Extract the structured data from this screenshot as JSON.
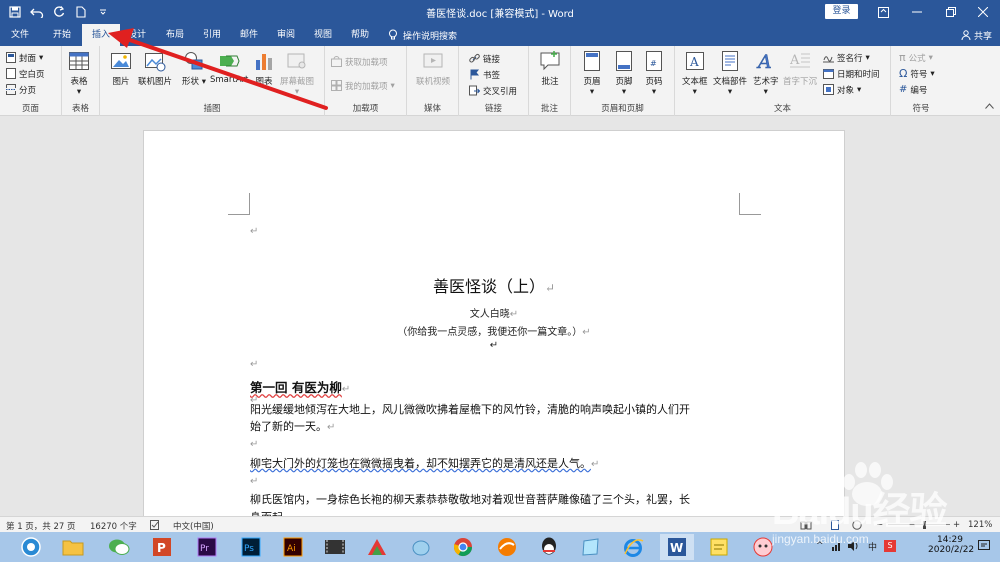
{
  "window": {
    "title": "善医怪谈.doc [兼容模式] - Word",
    "login_label": "登录"
  },
  "tabs": [
    {
      "label": "文件"
    },
    {
      "label": "开始"
    },
    {
      "label": "插入"
    },
    {
      "label": "设计"
    },
    {
      "label": "布局"
    },
    {
      "label": "引用"
    },
    {
      "label": "邮件"
    },
    {
      "label": "审阅"
    },
    {
      "label": "视图"
    },
    {
      "label": "帮助"
    }
  ],
  "active_tab": "插入",
  "tell_me": "操作说明搜索",
  "share": "共享",
  "ribbon": {
    "pages": {
      "label": "页面",
      "cover": "封面",
      "blank": "空白页",
      "break": "分页"
    },
    "tables": {
      "label": "表格",
      "table": "表格"
    },
    "illustrations": {
      "label": "插图",
      "picture": "图片",
      "online_picture": "联机图片",
      "shapes": "形状",
      "smartart": "SmartArt",
      "chart": "图表",
      "screenshot": "屏幕截图"
    },
    "addins": {
      "label": "加载项",
      "get": "获取加载项",
      "my": "我的加载项"
    },
    "media": {
      "label": "媒体",
      "video": "联机视频"
    },
    "links": {
      "label": "链接",
      "link": "链接",
      "bookmark": "书签",
      "crossref": "交叉引用"
    },
    "comments": {
      "label": "批注",
      "comment": "批注"
    },
    "header_footer": {
      "label": "页眉和页脚",
      "header": "页眉",
      "footer": "页脚",
      "page_number": "页码"
    },
    "text": {
      "label": "文本",
      "textbox": "文本框",
      "quickparts": "文档部件",
      "wordart": "艺术字",
      "dropcap": "首字下沉",
      "signature": "签名行",
      "datetime": "日期和时间",
      "object": "对象"
    },
    "symbols": {
      "label": "符号",
      "equation": "公式",
      "symbol": "符号",
      "number": "编号"
    }
  },
  "document": {
    "title": "善医怪谈（上）",
    "author": "文人白晓",
    "tagline": "（你给我一点灵感，我便还你一篇文章。）",
    "chapter": "第一回  有医为柳",
    "para1_line1": "阳光缓缓地倾泻在大地上，风儿微微吹拂着屋檐下的风竹铃，清脆的响声唤起小镇的人们开",
    "para1_line2": "始了新的一天。",
    "para2": "柳宅大门外的灯笼也在微微摇曳着，却不知摆弄它的是清风还是人气。",
    "para3_line1": "柳氏医馆内，一身棕色长袍的柳天素恭恭敬敬地对着观世音菩萨雕像磕了三个头，礼罢，长",
    "para3_line2": "身而起"
  },
  "status": {
    "page": "第 1 页，共 27 页",
    "words": "16270 个字",
    "lang": "中文(中国)",
    "zoom": "121%"
  },
  "taskbar": {
    "clock_time": "14:29",
    "clock_date": "2020/2/22"
  },
  "watermark": {
    "brand": "Baidu经验",
    "url": "jingyan.baidu.com"
  },
  "colors": {
    "word_blue": "#2b579a",
    "annotation_arrow": "#e02020"
  }
}
